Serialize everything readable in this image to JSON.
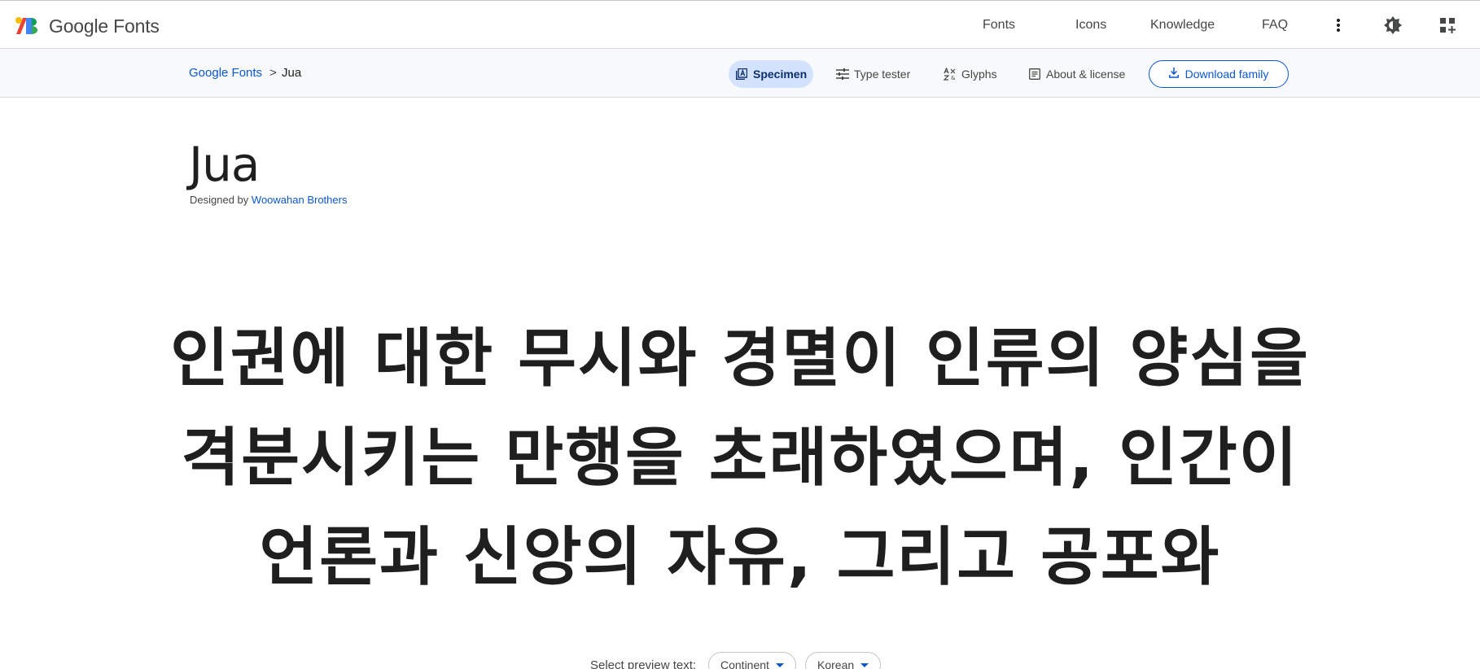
{
  "app": {
    "brand": "Google Fonts"
  },
  "topnav": {
    "links": [
      "Fonts",
      "Icons",
      "Knowledge",
      "FAQ"
    ],
    "icons": [
      "more-vert-icon",
      "brightness-icon",
      "apps-icon"
    ]
  },
  "breadcrumb": {
    "root": "Google Fonts",
    "separator": ">",
    "current": "Jua"
  },
  "tabs": {
    "specimen": "Specimen",
    "type_tester": "Type tester",
    "glyphs": "Glyphs",
    "about": "About & license",
    "active": "Specimen"
  },
  "download": {
    "label": "Download family"
  },
  "family": {
    "name": "Jua",
    "designed_by_prefix": "Designed by",
    "designer": "Woowahan Brothers"
  },
  "specimen": {
    "lines": [
      "인권에 대한 무시와 경멸이 인류의 양심을",
      "격분시키는 만행을 초래하였으며, 인간이",
      "언론과 신앙의 자유, 그리고 공포와"
    ]
  },
  "preview": {
    "label": "Select preview text:",
    "region": "Continent",
    "language": "Korean"
  },
  "colors": {
    "accent": "#0b57d0",
    "active_tab_bg": "#d3e3fd",
    "subbar_bg": "#f8f9fa",
    "text": "#1f1f1f",
    "muted": "#444746"
  }
}
